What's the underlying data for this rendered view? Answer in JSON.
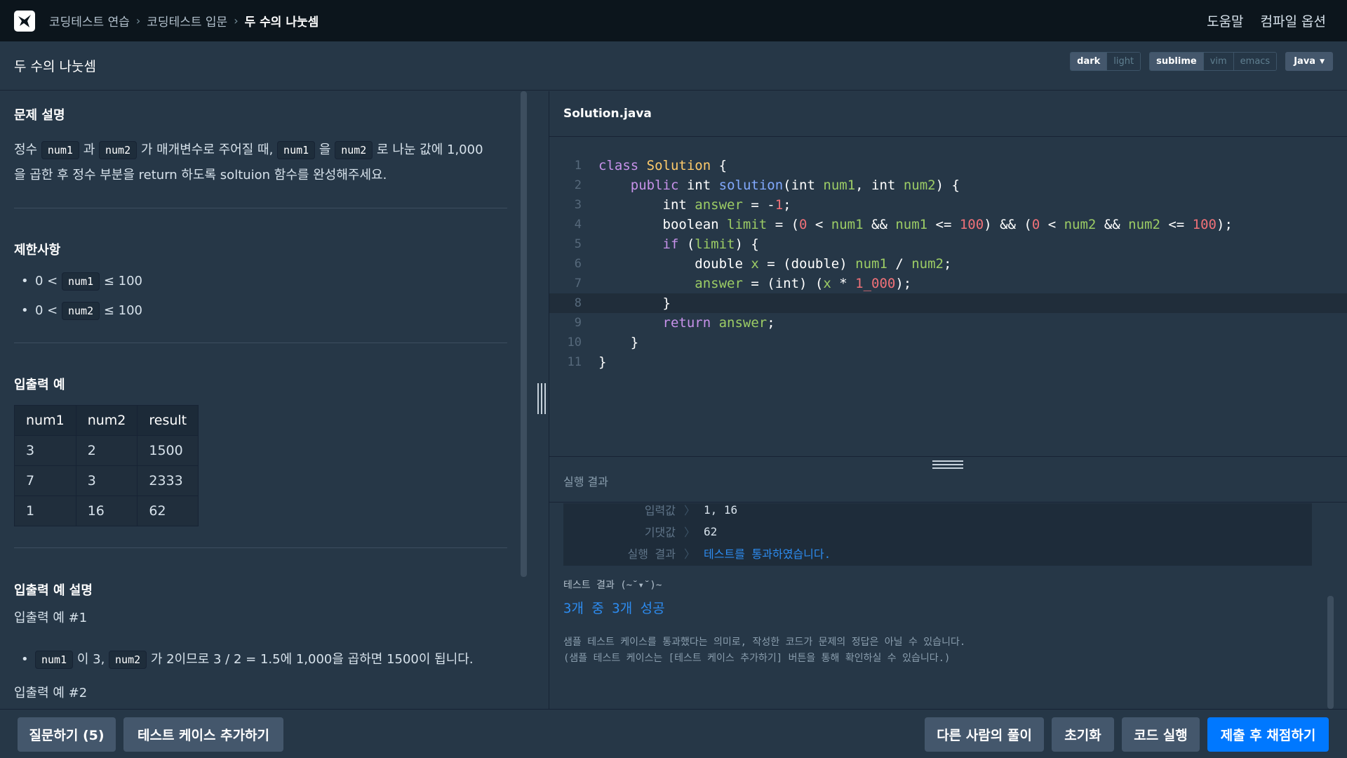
{
  "nav": {
    "breadcrumb": [
      "코딩테스트 연습",
      "코딩테스트 입문",
      "두 수의 나눗셈"
    ],
    "help": "도움말",
    "compile_options": "컴파일 옵션"
  },
  "title": "두 수의 나눗셈",
  "editor_options": {
    "themes": [
      "dark",
      "light"
    ],
    "active_theme": "dark",
    "keymaps": [
      "sublime",
      "vim",
      "emacs"
    ],
    "active_keymap": "sublime",
    "language": "Java"
  },
  "problem": {
    "description_title": "문제 설명",
    "description": {
      "p1": "정수 ",
      "c1": "num1",
      "p2": " 과 ",
      "c2": "num2",
      "p3": " 가 매개변수로 주어질 때, ",
      "c3": "num1",
      "p4": " 을 ",
      "c4": "num2",
      "p5": " 로 나눈 값에 1,000",
      "line2": "을 곱한 후 정수 부분을 return 하도록 soltuion 함수를 완성해주세요."
    },
    "constraints_title": "제한사항",
    "constraints": [
      {
        "pre": "0 < ",
        "code": "num1",
        "post": " ≤ 100"
      },
      {
        "pre": "0 < ",
        "code": "num2",
        "post": " ≤ 100"
      }
    ],
    "examples_title": "입출력 예",
    "examples_table": {
      "headers": [
        "num1",
        "num2",
        "result"
      ],
      "rows": [
        [
          "3",
          "2",
          "1500"
        ],
        [
          "7",
          "3",
          "2333"
        ],
        [
          "1",
          "16",
          "62"
        ]
      ]
    },
    "explanation_title": "입출력 예 설명",
    "example1_label": "입출력 예 #1",
    "example1": {
      "c1": "num1",
      "t1": " 이 3, ",
      "c2": "num2",
      "t2": " 가 2이므로 3 / 2 = 1.5에 1,000을 곱하면 1500이 됩니다."
    },
    "example2_label": "입출력 예 #2"
  },
  "editor": {
    "filename": "Solution.java",
    "line_numbers": [
      "1",
      "2",
      "3",
      "4",
      "5",
      "6",
      "7",
      "8",
      "9",
      "10",
      "11"
    ],
    "t": {
      "class": "class",
      "Solution": "Solution",
      "public": "public",
      "int": "int",
      "solution": "solution",
      "num1": "num1",
      "num2": "num2",
      "answer": "answer",
      "boolean": "boolean",
      "limit": "limit",
      "if": "if",
      "double": "double",
      "x": "x",
      "return": "return",
      "n0": "0",
      "n1": "1",
      "n100": "100",
      "n1000": "1_000"
    }
  },
  "result": {
    "title": "실행 결과",
    "case": {
      "input_label": "입력값",
      "input": "1, 16",
      "expected_label": "기댓값",
      "expected": "62",
      "result_label": "실행 결과",
      "result": "테스트를 통과하였습니다."
    },
    "summary_title": "테스트 결과 (~˘▾˘)~",
    "summary": "3개 중 3개 성공",
    "note1": "샘플 테스트 케이스를 통과했다는 의미로, 작성한 코드가 문제의 정답은 아닐 수 있습니다.",
    "note2": "(샘플 테스트 케이스는 [테스트 케이스 추가하기] 버튼을 통해 확인하실 수 있습니다.)"
  },
  "buttons": {
    "question": "질문하기 (5)",
    "add_testcase": "테스트 케이스 추가하기",
    "others_solutions": "다른 사람의 풀이",
    "reset": "초기화",
    "run": "코드 실행",
    "submit": "제출 후 채점하기"
  },
  "colors": {
    "primary": "#0078ff",
    "background": "#263747",
    "topbar": "#0c151c"
  }
}
